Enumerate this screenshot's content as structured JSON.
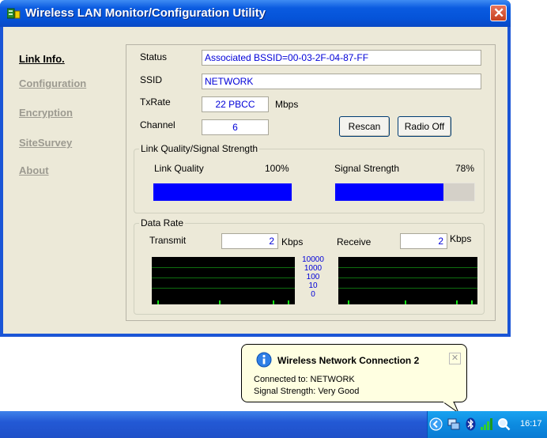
{
  "window": {
    "title": "Wireless LAN Monitor/Configuration Utility"
  },
  "nav": {
    "items": [
      {
        "label": "Link Info.",
        "active": true
      },
      {
        "label": "Configuration",
        "active": false
      },
      {
        "label": "Encryption",
        "active": false
      },
      {
        "label": "SiteSurvey",
        "active": false
      },
      {
        "label": "About",
        "active": false
      }
    ]
  },
  "link_info": {
    "status_label": "Status",
    "status_value": "Associated BSSID=00-03-2F-04-87-FF",
    "ssid_label": "SSID",
    "ssid_value": "NETWORK",
    "txrate_label": "TxRate",
    "txrate_value": "22 PBCC",
    "txrate_unit": "Mbps",
    "channel_label": "Channel",
    "channel_value": "6",
    "rescan_label": "Rescan",
    "radio_off_label": "Radio Off"
  },
  "signal": {
    "group_title": "Link Quality/Signal Strength",
    "link_quality_label": "Link Quality",
    "link_quality_value": "100%",
    "link_quality_fraction": 1.0,
    "signal_strength_label": "Signal Strength",
    "signal_strength_value": "78%",
    "signal_strength_fraction": 0.78,
    "bar_color": "#0000ff"
  },
  "data_rate": {
    "group_title": "Data Rate",
    "transmit_label": "Transmit",
    "transmit_value": "2",
    "transmit_unit": "Kbps",
    "receive_label": "Receive",
    "receive_value": "2",
    "receive_unit": "Kbps",
    "scale_labels": [
      "10000",
      "1000",
      "100",
      "10",
      "0"
    ],
    "graph_line_color": "#13e013"
  },
  "notification": {
    "title": "Wireless Network Connection 2",
    "line1": "Connected to: NETWORK",
    "line2": "Signal Strength: Very Good",
    "icon": "info-icon"
  },
  "taskbar": {
    "clock": "16:17",
    "tray_icons": [
      "show-hidden-icons-icon",
      "network-connection-icon",
      "bluetooth-icon",
      "wireless-signal-icon",
      "search-icon"
    ]
  }
}
